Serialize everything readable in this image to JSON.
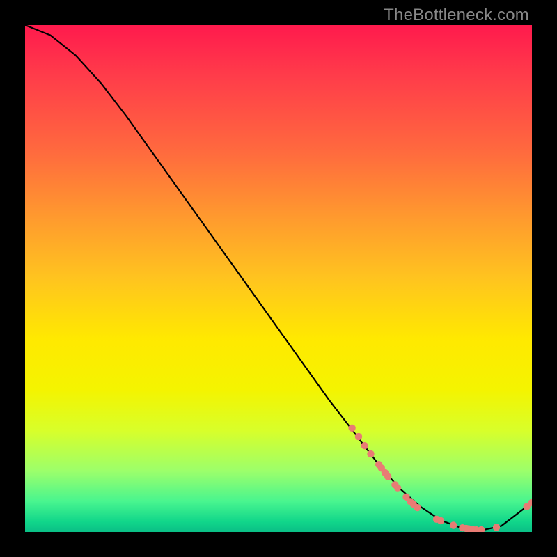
{
  "watermark": "TheBottleneck.com",
  "colors": {
    "gradient_top": "#ff1a4d",
    "gradient_mid": "#ffe900",
    "gradient_bottom": "#0abf86",
    "background": "#000000",
    "curve": "#000000",
    "dot": "#e87c74"
  },
  "chart_data": {
    "type": "line",
    "title": "",
    "xlabel": "",
    "ylabel": "",
    "xlim": [
      0,
      100
    ],
    "ylim": [
      0,
      100
    ],
    "grid": false,
    "legend": false,
    "series": [
      {
        "name": "bottleneck-curve",
        "x": [
          0,
          5,
          10,
          15,
          20,
          25,
          30,
          35,
          40,
          45,
          50,
          55,
          60,
          65,
          70,
          74,
          78,
          82,
          86,
          90,
          94,
          100
        ],
        "y": [
          100,
          98,
          94,
          88.5,
          82,
          75,
          68,
          61,
          54,
          47,
          40,
          33,
          26,
          19.5,
          13,
          8.5,
          5,
          2.3,
          0.8,
          0.3,
          1.2,
          5.8
        ]
      }
    ],
    "dots": {
      "name": "markers",
      "points": [
        {
          "x": 64.5,
          "y": 20.5
        },
        {
          "x": 65.8,
          "y": 18.8
        },
        {
          "x": 67.0,
          "y": 17.0
        },
        {
          "x": 68.2,
          "y": 15.4
        },
        {
          "x": 69.8,
          "y": 13.3
        },
        {
          "x": 70.3,
          "y": 12.6
        },
        {
          "x": 71.0,
          "y": 11.7
        },
        {
          "x": 71.6,
          "y": 10.9
        },
        {
          "x": 73.0,
          "y": 9.3
        },
        {
          "x": 73.5,
          "y": 8.7
        },
        {
          "x": 75.2,
          "y": 6.9
        },
        {
          "x": 76.0,
          "y": 6.0
        },
        {
          "x": 76.6,
          "y": 5.5
        },
        {
          "x": 77.4,
          "y": 4.8
        },
        {
          "x": 81.2,
          "y": 2.5
        },
        {
          "x": 82.0,
          "y": 2.2
        },
        {
          "x": 84.5,
          "y": 1.3
        },
        {
          "x": 86.3,
          "y": 0.8
        },
        {
          "x": 87.0,
          "y": 0.7
        },
        {
          "x": 87.5,
          "y": 0.6
        },
        {
          "x": 88.3,
          "y": 0.5
        },
        {
          "x": 89.0,
          "y": 0.4
        },
        {
          "x": 90.0,
          "y": 0.4
        },
        {
          "x": 93.0,
          "y": 0.9
        },
        {
          "x": 99.0,
          "y": 5.0
        },
        {
          "x": 100.0,
          "y": 5.8
        }
      ]
    }
  }
}
